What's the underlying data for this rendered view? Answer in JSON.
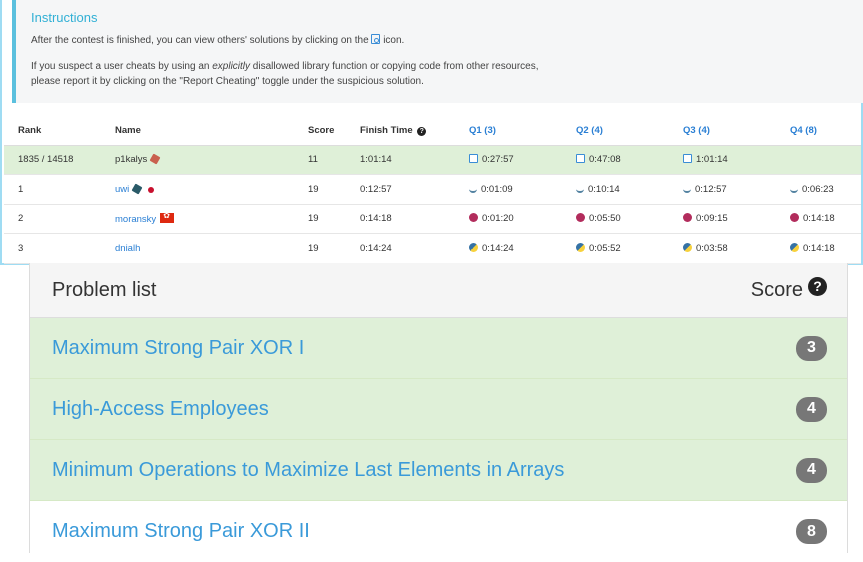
{
  "instructions": {
    "title": "Instructions",
    "p1_before": "After the contest is finished, you can view others' solutions by clicking on the ",
    "p1_after": " icon.",
    "p2_a": "If you suspect a user cheats by using an ",
    "p2_em": "explicitly",
    "p2_b": " disallowed library function or copying code from other resources,",
    "p2_c": "please report it by clicking on the \"Report Cheating\" toggle under the suspicious solution."
  },
  "ranking": {
    "headers": [
      "Rank",
      "Name",
      "Score",
      "Finish Time",
      "Q1 (3)",
      "Q2 (4)",
      "Q3 (4)",
      "Q4 (8)"
    ],
    "rows": [
      {
        "rank": "1835 / 14518",
        "name": "p1kalys",
        "score": "11",
        "finish": "1:01:14",
        "q1": "0:27:57",
        "q2": "0:47:08",
        "q3": "1:01:14",
        "q4": ""
      },
      {
        "rank": "1",
        "name": "uwi",
        "score": "19",
        "finish": "0:12:57",
        "q1": "0:01:09",
        "q2": "0:10:14",
        "q3": "0:12:57",
        "q4": "0:06:23"
      },
      {
        "rank": "2",
        "name": "moransky",
        "score": "19",
        "finish": "0:14:18",
        "q1": "0:01:20",
        "q2": "0:05:50",
        "q3": "0:09:15",
        "q4": "0:14:18"
      },
      {
        "rank": "3",
        "name": "dnialh",
        "score": "19",
        "finish": "0:14:24",
        "q1": "0:14:24",
        "q2": "0:05:52",
        "q3": "0:03:58",
        "q4": "0:14:18"
      }
    ]
  },
  "problem_list": {
    "title": "Problem list",
    "score_label": "Score",
    "help_glyph": "?",
    "problems": [
      {
        "name": "Maximum Strong Pair XOR I",
        "score": "3"
      },
      {
        "name": "High-Access Employees",
        "score": "4"
      },
      {
        "name": "Minimum Operations to Maximize Last Elements in Arrays",
        "score": "4"
      },
      {
        "name": "Maximum Strong Pair XOR II",
        "score": "8"
      }
    ]
  },
  "colors": {
    "accent": "#5bc0de",
    "link": "#2a7fd4",
    "solved_bg": "#dff0d8",
    "badge": "#777777"
  }
}
